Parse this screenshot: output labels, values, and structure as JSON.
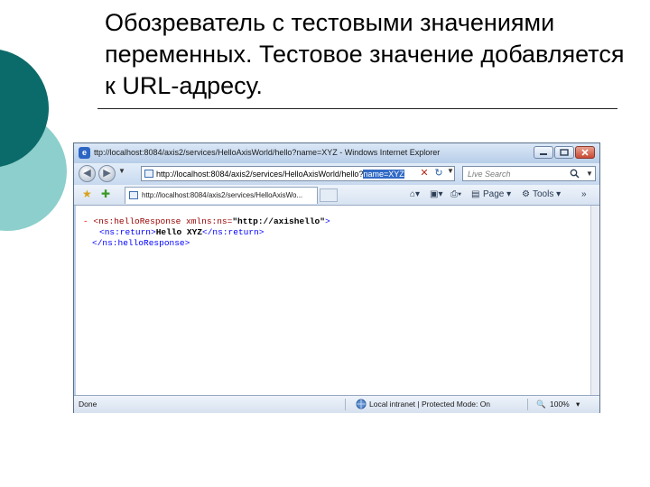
{
  "slide": {
    "title": "Обозреватель с тестовыми значениями переменных. Тестовое значение добавляется к URL-адресу.",
    "colors": {
      "deco_dark": "#0b6b6a",
      "deco_light": "#8ccfcc"
    }
  },
  "browser": {
    "window_title": "ttp://localhost:8084/axis2/services/HelloAxisWorld/hello?name=XYZ - Windows Internet Explorer",
    "address": {
      "url_prefix": "http://localhost:8084/axis2/services/HelloAxisWorld/hello?",
      "url_selected": "name=XYZ"
    },
    "search": {
      "placeholder": "Live Search"
    },
    "tab": {
      "label": "http://localhost:8084/axis2/services/HelloAxisWo..."
    },
    "toolbar": {
      "page_label": "Page",
      "tools_label": "Tools"
    },
    "content": {
      "line1": {
        "minus": "-",
        "open_tag": "<ns:helloResponse",
        "attr": " xmlns:ns=",
        "attr_value": "\"http://axishello\"",
        "close": ">"
      },
      "line2": {
        "open_tag": "<ns:return>",
        "text": "Hello XYZ",
        "close_tag": "</ns:return>"
      },
      "line3": {
        "close_tag": "</ns:helloResponse>"
      }
    },
    "status": {
      "left": "Done",
      "zone": "Local intranet | Protected Mode: On",
      "zoom": "100%"
    }
  }
}
